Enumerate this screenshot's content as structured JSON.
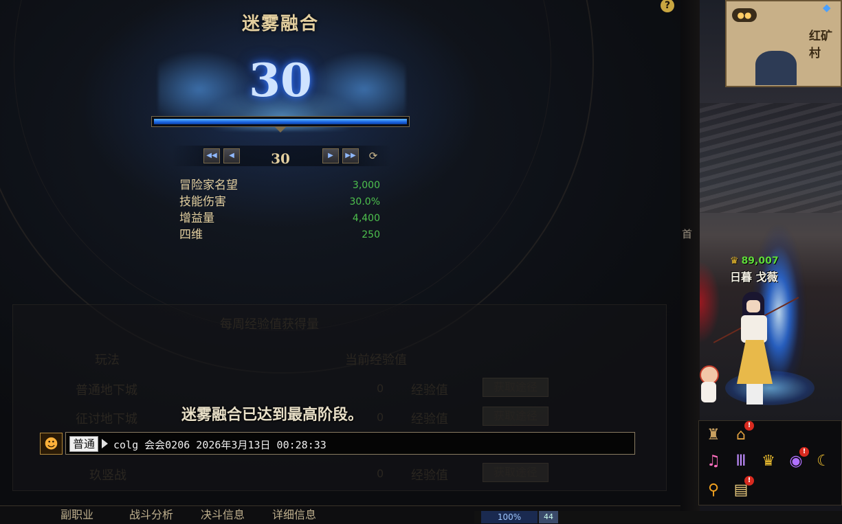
{
  "panel": {
    "title": "迷雾融合",
    "level": "30",
    "progress": 1.0,
    "pager_level": "30",
    "stats": [
      {
        "name": "冒险家名望",
        "value": "3,000"
      },
      {
        "name": "技能伤害",
        "value": "30.0%"
      },
      {
        "name": "增益量",
        "value": "4,400"
      },
      {
        "name": "四维",
        "value": "250"
      }
    ],
    "notice": "迷雾融合已达到最高阶段。",
    "help_icon": "?"
  },
  "table": {
    "title": "每周经验值获得量",
    "col_mode": "玩法",
    "col_exp": "当前经验值",
    "rows": [
      {
        "label": "普通地下城",
        "value": "0",
        "unit": "经验值",
        "button": "获取途径"
      },
      {
        "label": "征讨地下城",
        "value": "0",
        "unit": "经验值",
        "button": "获取途径"
      },
      {
        "label": "玖竖战",
        "value": "0",
        "unit": "经验值",
        "button": "获取途径"
      }
    ]
  },
  "chat": {
    "channel": "普通",
    "message": "colg 会会0206 2026年3月13日 00:28:33"
  },
  "bottom_tabs": [
    "副职业",
    "战斗分析",
    "决斗信息",
    "详细信息"
  ],
  "hud": {
    "exp_pct": "100%",
    "level": "44"
  },
  "world": {
    "minimap_location": "红矿村",
    "character_power": "89,007",
    "character_name": "日暮 戈薇",
    "side_glyph": "首"
  },
  "hotbar_icons": [
    "character-icon",
    "house-icon",
    "music-icon",
    "guild-icon",
    "crown-icon",
    "orb-icon",
    "moon-icon",
    "location-pin-icon",
    "book-icon"
  ]
}
